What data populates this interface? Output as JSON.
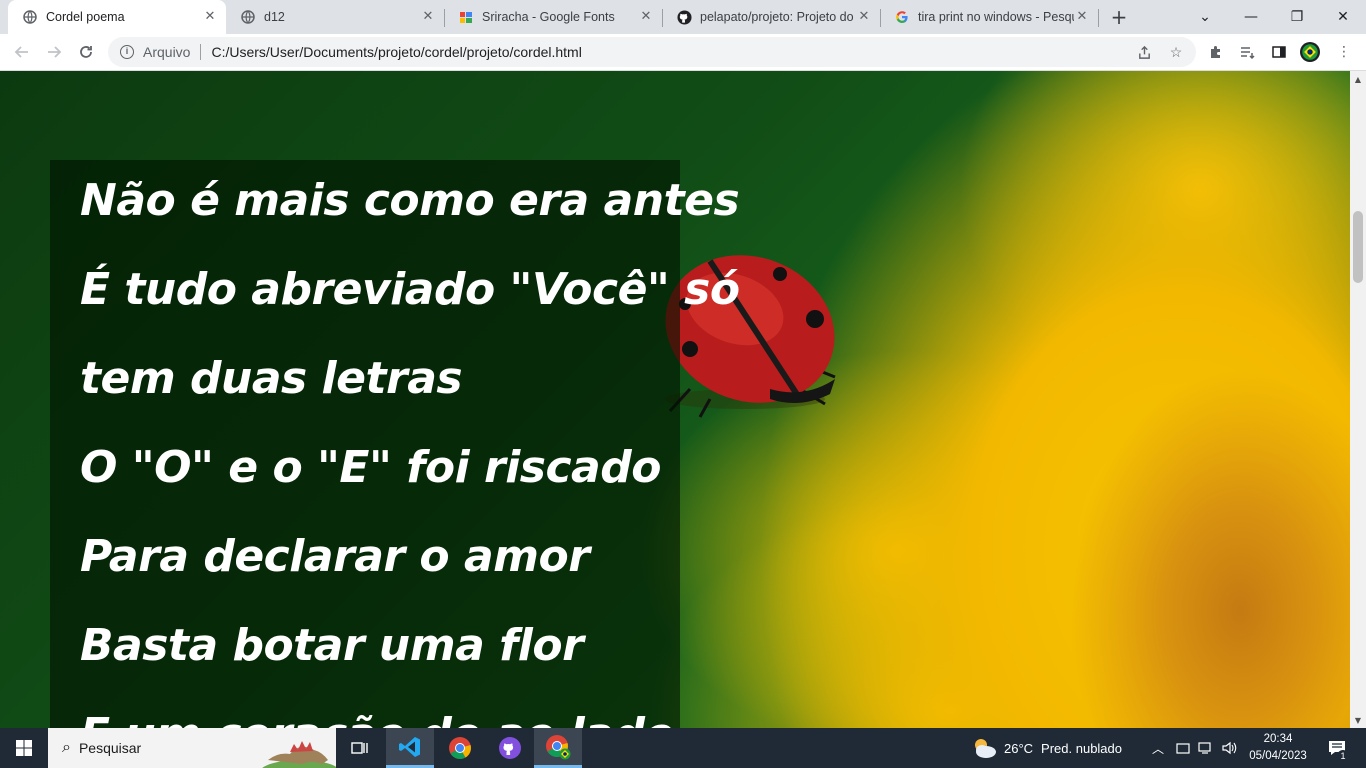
{
  "browser": {
    "tabs": [
      {
        "title": "Cordel poema",
        "icon": "globe-icon",
        "active": true
      },
      {
        "title": "d12",
        "icon": "globe-icon",
        "active": false
      },
      {
        "title": "Sriracha - Google Fonts",
        "icon": "google-fonts-icon",
        "active": false
      },
      {
        "title": "pelapato/projeto: Projeto do",
        "icon": "github-icon",
        "active": false
      },
      {
        "title": "tira print no windows - Pesqu",
        "icon": "google-icon",
        "active": false
      }
    ],
    "new_tab_symbol": "+",
    "omnibox": {
      "origin_label": "Arquivo",
      "url": "C:/Users/User/Documents/projeto/cordel/projeto/cordel.html"
    }
  },
  "page": {
    "poem_lines": [
      "Não é mais como era antes",
      "É tudo abreviado \"Você\" só",
      "tem duas letras",
      "O \"O\" e o \"E\" foi riscado",
      "Para declarar o amor",
      "Basta botar uma flor",
      "E um coração do ao lado"
    ],
    "background_image": "ladybug-on-yellow-flower"
  },
  "taskbar": {
    "search_placeholder": "Pesquisar",
    "apps": [
      "task-view-icon",
      "vscode-icon",
      "chrome-icon",
      "github-desktop-icon",
      "chrome-profile-icon"
    ],
    "weather": {
      "temp": "26°C",
      "condition": "Pred. nublado"
    },
    "clock": {
      "time": "20:34",
      "date": "05/04/2023"
    },
    "notification_count": "1"
  },
  "colors": {
    "tabbar_bg": "#dee1e6",
    "taskbar_bg": "#1f2a36",
    "poem_text": "#ffffff",
    "flower_yellow": "#f6c500",
    "leaf_green": "#114d16"
  }
}
